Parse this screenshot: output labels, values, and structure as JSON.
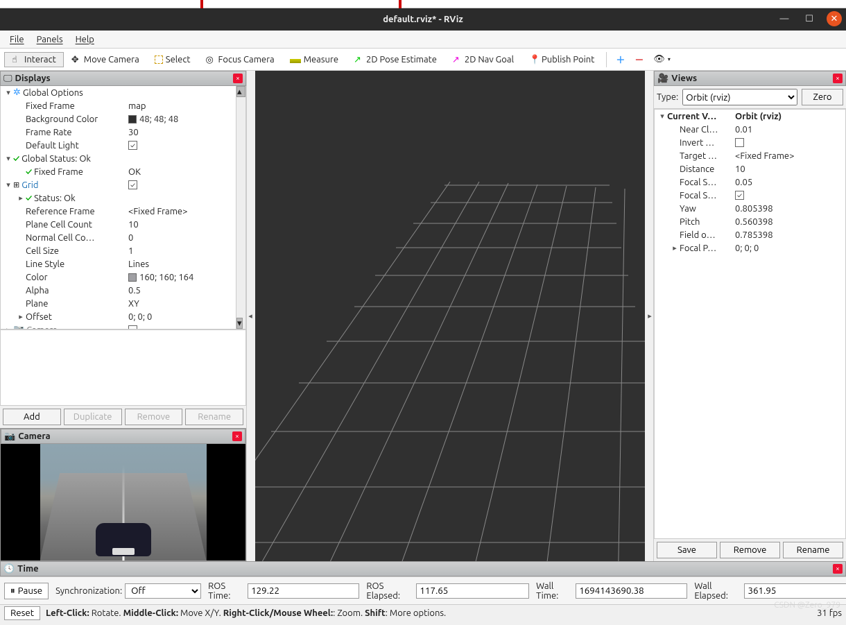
{
  "window": {
    "title": "default.rviz* - RViz"
  },
  "menubar": {
    "file": "File",
    "panels": "Panels",
    "help": "Help"
  },
  "toolbar": {
    "interact": "Interact",
    "move_camera": "Move Camera",
    "select": "Select",
    "focus_camera": "Focus Camera",
    "measure": "Measure",
    "pose_estimate": "2D Pose Estimate",
    "nav_goal": "2D Nav Goal",
    "publish_point": "Publish Point"
  },
  "displays_panel": {
    "title": "Displays",
    "tree": [
      {
        "indent": 0,
        "expander": "▾",
        "icon": "gear",
        "label": "Global Options"
      },
      {
        "indent": 1,
        "label": "Fixed Frame",
        "value": "map"
      },
      {
        "indent": 1,
        "label": "Background Color",
        "swatch": "#303030",
        "value": "48; 48; 48"
      },
      {
        "indent": 1,
        "label": "Frame Rate",
        "value": "30"
      },
      {
        "indent": 1,
        "label": "Default Light",
        "checkbox": true
      },
      {
        "indent": 0,
        "expander": "▾",
        "icon": "check",
        "label": "Global Status: Ok"
      },
      {
        "indent": 1,
        "icon": "check",
        "label": "Fixed Frame",
        "value": "OK"
      },
      {
        "indent": 0,
        "expander": "▾",
        "icon": "grid",
        "label": "Grid",
        "linky": true,
        "checkbox": true
      },
      {
        "indent": 1,
        "expander": "▸",
        "icon": "check",
        "label": "Status: Ok"
      },
      {
        "indent": 1,
        "label": "Reference Frame",
        "value": "<Fixed Frame>"
      },
      {
        "indent": 1,
        "label": "Plane Cell Count",
        "value": "10"
      },
      {
        "indent": 1,
        "label": "Normal Cell Co…",
        "value": "0"
      },
      {
        "indent": 1,
        "label": "Cell Size",
        "value": "1"
      },
      {
        "indent": 1,
        "label": "Line Style",
        "value": "Lines"
      },
      {
        "indent": 1,
        "label": "Color",
        "swatch": "#a0a0a4",
        "value": "160; 160; 164"
      },
      {
        "indent": 1,
        "label": "Alpha",
        "value": "0.5"
      },
      {
        "indent": 1,
        "label": "Plane",
        "value": "XY"
      },
      {
        "indent": 1,
        "expander": "▸",
        "label": "Offset",
        "value": "0; 0; 0"
      },
      {
        "indent": 0,
        "expander": "▸",
        "icon": "camera",
        "label": "Camera",
        "muted": true,
        "checkbox": false
      }
    ],
    "buttons": {
      "add": "Add",
      "duplicate": "Duplicate",
      "remove": "Remove",
      "rename": "Rename"
    }
  },
  "camera_panel": {
    "title": "Camera"
  },
  "views_panel": {
    "title": "Views",
    "type_label": "Type:",
    "type_value": "Orbit (rviz)",
    "zero_button": "Zero",
    "tree": [
      {
        "indent": 0,
        "expander": "▾",
        "label": "Current V…",
        "value": "Orbit (rviz)",
        "bold": true
      },
      {
        "indent": 1,
        "label": "Near Cl…",
        "value": "0.01"
      },
      {
        "indent": 1,
        "label": "Invert …",
        "checkbox": false
      },
      {
        "indent": 1,
        "label": "Target …",
        "value": "<Fixed Frame>"
      },
      {
        "indent": 1,
        "label": "Distance",
        "value": "10"
      },
      {
        "indent": 1,
        "label": "Focal S…",
        "value": "0.05"
      },
      {
        "indent": 1,
        "label": "Focal S…",
        "checkbox": true
      },
      {
        "indent": 1,
        "label": "Yaw",
        "value": "0.805398"
      },
      {
        "indent": 1,
        "label": "Pitch",
        "value": "0.560398"
      },
      {
        "indent": 1,
        "label": "Field o…",
        "value": "0.785398"
      },
      {
        "indent": 1,
        "expander": "▸",
        "label": "Focal P…",
        "value": "0; 0; 0"
      }
    ],
    "buttons": {
      "save": "Save",
      "remove": "Remove",
      "rename": "Rename"
    }
  },
  "time_panel": {
    "title": "Time",
    "pause": "Pause",
    "sync_label": "Synchronization:",
    "sync_value": "Off",
    "ros_time_label": "ROS Time:",
    "ros_time": "129.22",
    "ros_elapsed_label": "ROS Elapsed:",
    "ros_elapsed": "117.65",
    "wall_time_label": "Wall Time:",
    "wall_time": "1694143690.38",
    "wall_elapsed_label": "Wall Elapsed:",
    "wall_elapsed": "361.95"
  },
  "status_bar": {
    "reset": "Reset",
    "hint_html": "Left-Click: Rotate. Middle-Click: Move X/Y. Right-Click/Mouse Wheel:: Zoom. Shift: More options.",
    "fps": "31 fps",
    "watermark": "CSDN @Zero_979"
  }
}
